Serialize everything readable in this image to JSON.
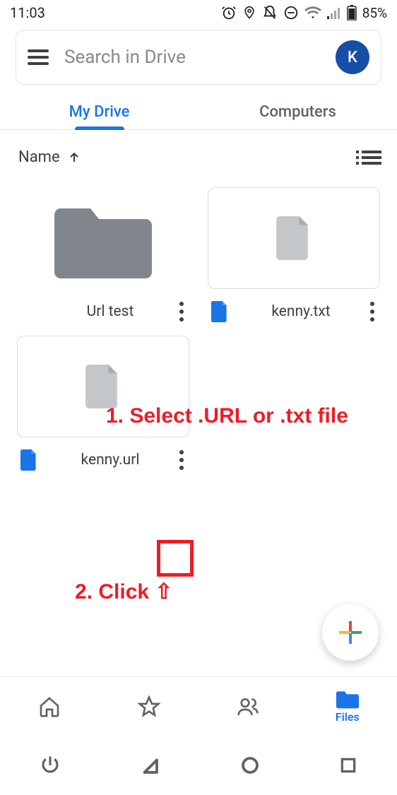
{
  "status": {
    "time": "11:03",
    "battery": "85%"
  },
  "search": {
    "placeholder": "Search in Drive",
    "avatar_initial": "K"
  },
  "tabs": {
    "mydrive": "My Drive",
    "computers": "Computers"
  },
  "sort": {
    "label": "Name"
  },
  "files": [
    {
      "name": "Url test",
      "type": "folder"
    },
    {
      "name": "kenny.txt",
      "type": "file"
    },
    {
      "name": "kenny.url",
      "type": "file"
    }
  ],
  "bottom_nav": {
    "files": "Files"
  },
  "annotations": {
    "step1": "1. Select .URL or .txt file",
    "step2": "2. Click ⇧"
  }
}
